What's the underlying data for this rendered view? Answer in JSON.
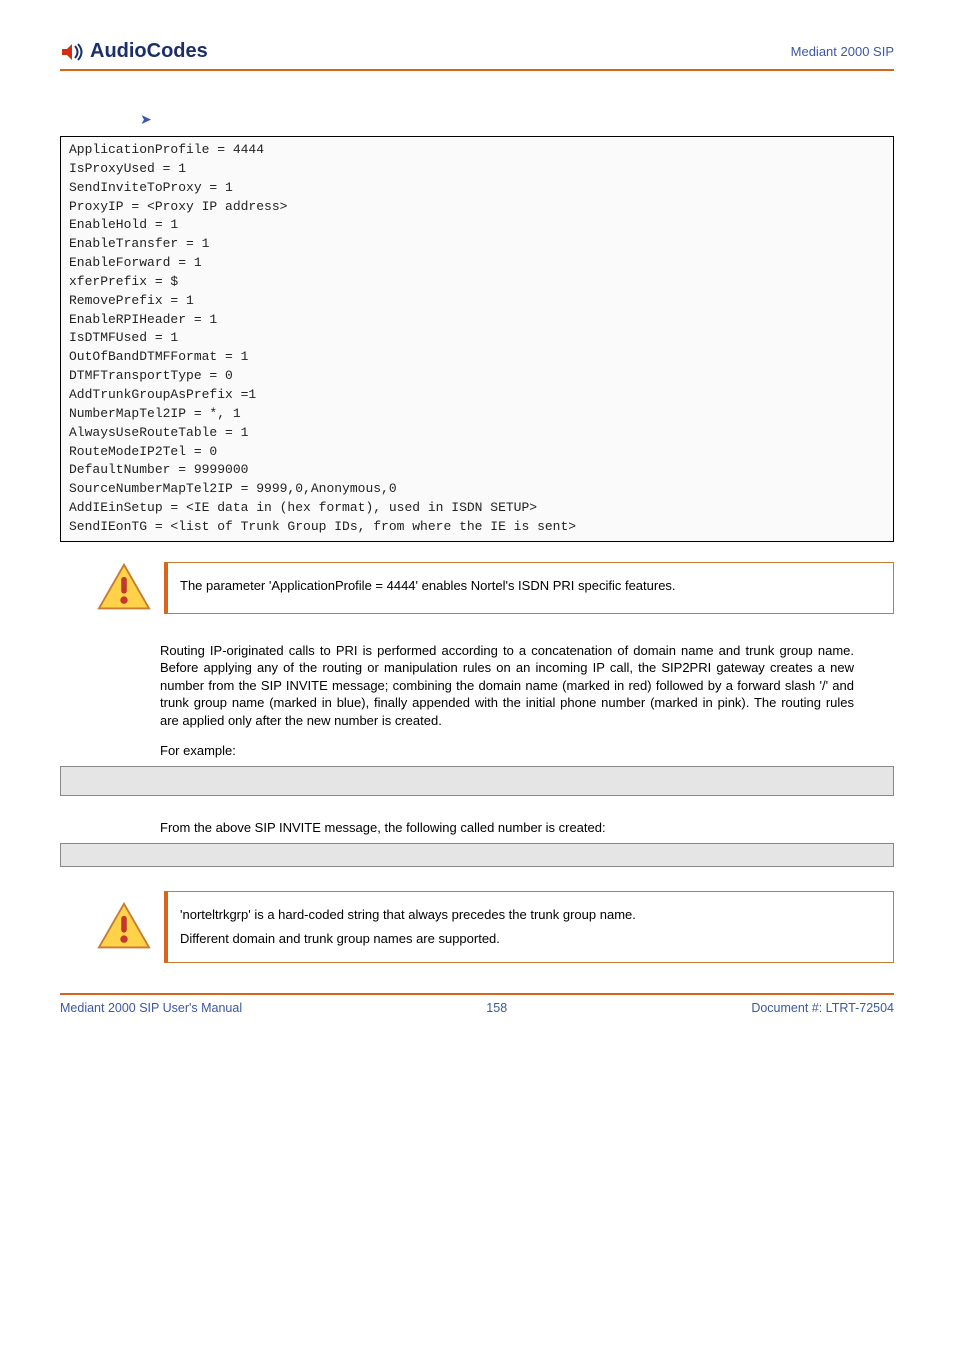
{
  "header": {
    "brand": "AudioCodes",
    "product": "Mediant 2000 SIP"
  },
  "top_arrow_text": "",
  "code_block": "ApplicationProfile = 4444\nIsProxyUsed = 1\nSendInviteToProxy = 1\nProxyIP = <Proxy IP address>\nEnableHold = 1\nEnableTransfer = 1\nEnableForward = 1\nxferPrefix = $\nRemovePrefix = 1\nEnableRPIHeader = 1\nIsDTMFUsed = 1\nOutOfBandDTMFFormat = 1\nDTMFTransportType = 0\nAddTrunkGroupAsPrefix =1\nNumberMapTel2IP = *, 1\nAlwaysUseRouteTable = 1\nRouteModeIP2Tel = 0\nDefaultNumber = 9999000\nSourceNumberMapTel2IP = 9999,0,Anonymous,0\nAddIEinSetup = <IE data in (hex format), used in ISDN SETUP>\nSendIEonTG = <list of Trunk Group IDs, from where the IE is sent>",
  "note1": "The parameter 'ApplicationProfile = 4444' enables Nortel's ISDN PRI specific features.",
  "para1": "Routing IP-originated calls to PRI is performed according to a concatenation of domain name and trunk group name. Before applying any of the routing or manipulation rules on an incoming IP call, the SIP2PRI gateway creates a new number from the SIP INVITE message; combining the domain name (marked in red) followed by a forward slash '/' and trunk group name (marked in blue), finally appended with the initial phone number (marked in pink). The routing rules are applied only after the new number is created.",
  "example_label": "For example:",
  "followup_text": "From the above SIP INVITE message, the following called number is created:",
  "note2_a": "'norteltrkgrp' is a hard-coded string that always precedes the trunk group name.",
  "note2_b": "Different domain and trunk group names are supported.",
  "footer": {
    "left": "Mediant 2000 SIP User's Manual",
    "center": "158",
    "right": "Document #: LTRT-72504"
  }
}
